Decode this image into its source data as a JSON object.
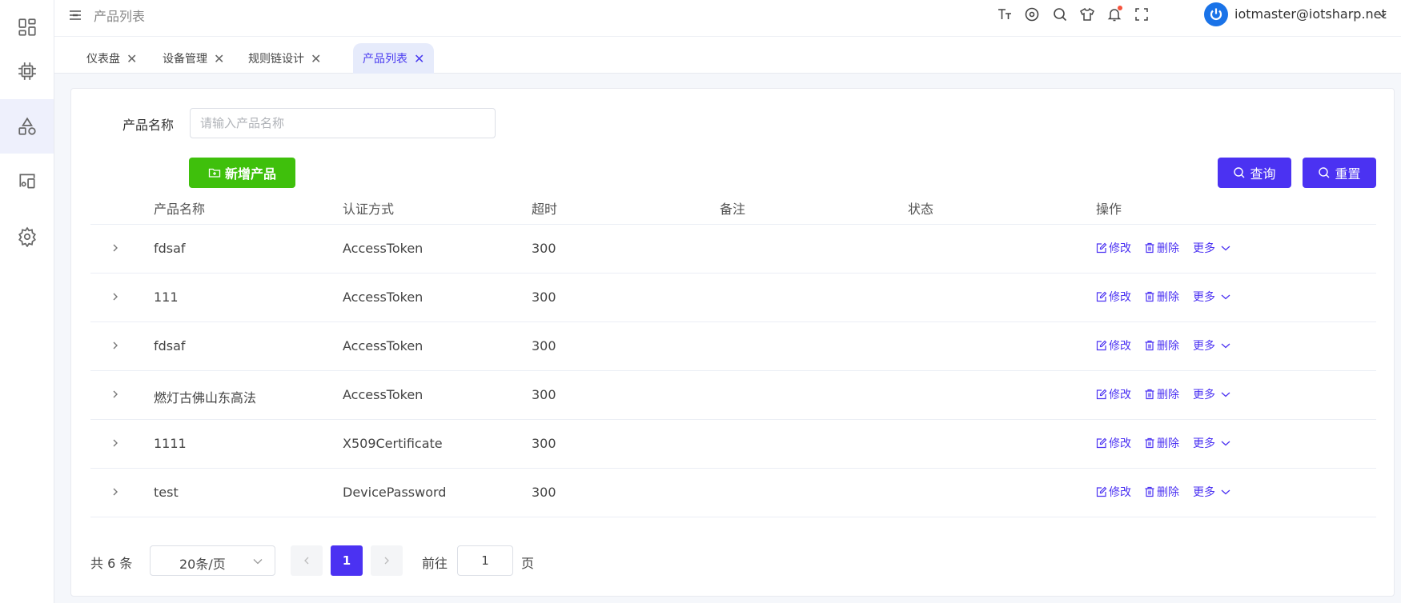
{
  "header": {
    "breadcrumb": "产品列表",
    "username": "iotmaster@iotsharp.net"
  },
  "tabs": [
    {
      "label": "仪表盘",
      "active": false
    },
    {
      "label": "设备管理",
      "active": false
    },
    {
      "label": "规则链设计",
      "active": false
    },
    {
      "label": "产品列表",
      "active": true
    }
  ],
  "search": {
    "label": "产品名称",
    "placeholder": "请输入产品名称",
    "value": ""
  },
  "buttons": {
    "add": "新增产品",
    "query": "查询",
    "reset": "重置"
  },
  "table": {
    "columns": [
      "产品名称",
      "认证方式",
      "超时",
      "备注",
      "状态",
      "操作"
    ],
    "rows": [
      {
        "name": "fdsaf",
        "auth": "AccessToken",
        "timeout": "300",
        "remark": "",
        "status": ""
      },
      {
        "name": "111",
        "auth": "AccessToken",
        "timeout": "300",
        "remark": "",
        "status": ""
      },
      {
        "name": "fdsaf",
        "auth": "AccessToken",
        "timeout": "300",
        "remark": "",
        "status": ""
      },
      {
        "name": "燃灯古佛山东高法",
        "auth": "AccessToken",
        "timeout": "300",
        "remark": "",
        "status": ""
      },
      {
        "name": "1111",
        "auth": "X509Certificate",
        "timeout": "300",
        "remark": "",
        "status": ""
      },
      {
        "name": "test",
        "auth": "DevicePassword",
        "timeout": "300",
        "remark": "",
        "status": ""
      }
    ],
    "actions": {
      "edit": "修改",
      "delete": "删除",
      "more": "更多"
    }
  },
  "pagination": {
    "total": "共 6 条",
    "page_size": "20条/页",
    "current_page": "1",
    "goto_label": "前往",
    "goto_value": "1",
    "goto_suffix": "页"
  },
  "icons": {
    "sidebar": [
      "dashboard-icon",
      "chip-icon",
      "shapes-icon",
      "devices-icon",
      "settings-icon"
    ],
    "header": [
      "font-size-icon",
      "github-icon",
      "search-icon",
      "theme-icon",
      "bell-icon",
      "fullscreen-icon"
    ]
  },
  "colors": {
    "primary": "#4b32f2",
    "success": "#3fc00c",
    "sidebar_active": "#eef0fc"
  }
}
